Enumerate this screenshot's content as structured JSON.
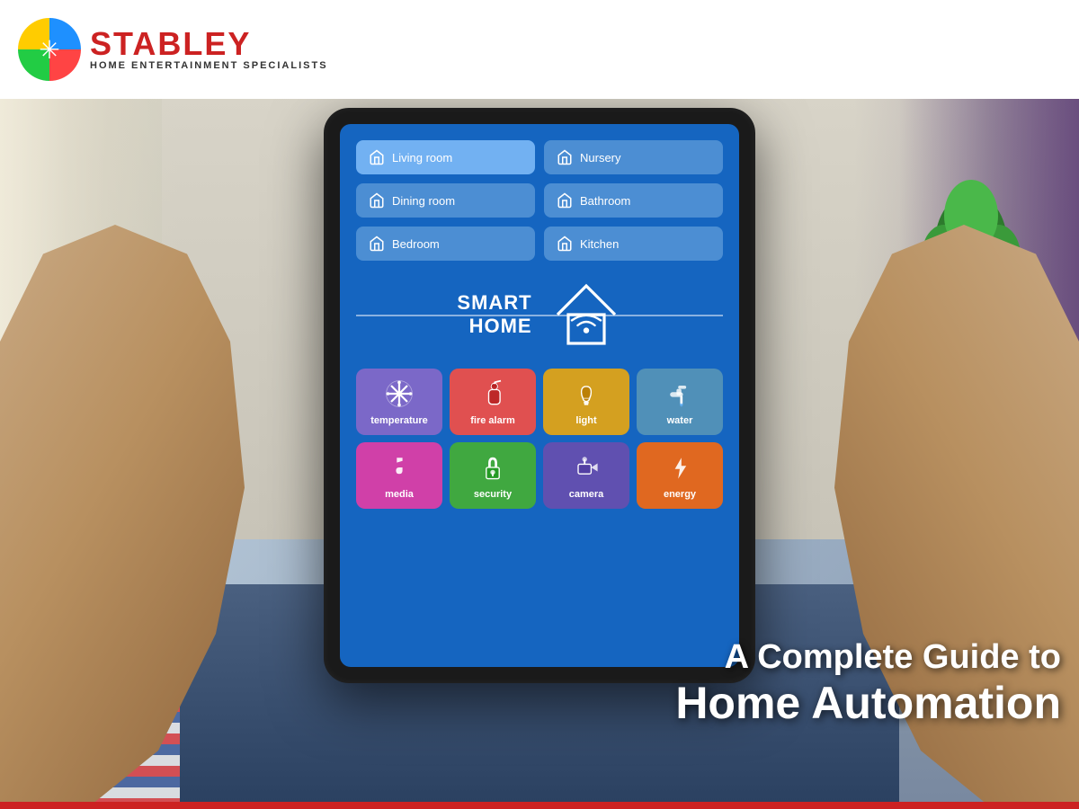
{
  "header": {
    "logo_name": "STABLEY",
    "logo_subtitle": "HOME ENTERTAINMENT SPECIALISTS"
  },
  "tablet": {
    "rooms": [
      {
        "id": "living-room",
        "label": "Living room",
        "active": true
      },
      {
        "id": "nursery",
        "label": "Nursery",
        "active": false
      },
      {
        "id": "dining-room",
        "label": "Dining room",
        "active": false
      },
      {
        "id": "bathroom",
        "label": "Bathroom",
        "active": false
      },
      {
        "id": "bedroom",
        "label": "Bedroom",
        "active": false
      },
      {
        "id": "kitchen",
        "label": "Kitchen",
        "active": false
      }
    ],
    "smart_home_line1": "SMART",
    "smart_home_line2": "HOME",
    "controls": [
      {
        "id": "temperature",
        "label": "temperature",
        "color": "ctrl-temperature"
      },
      {
        "id": "fire-alarm",
        "label": "fire alarm",
        "color": "ctrl-fire"
      },
      {
        "id": "light",
        "label": "light",
        "color": "ctrl-light"
      },
      {
        "id": "water",
        "label": "water",
        "color": "ctrl-water"
      },
      {
        "id": "media",
        "label": "media",
        "color": "ctrl-media"
      },
      {
        "id": "security",
        "label": "security",
        "color": "ctrl-security"
      },
      {
        "id": "camera",
        "label": "camera",
        "color": "ctrl-camera"
      },
      {
        "id": "energy",
        "label": "energy",
        "color": "ctrl-energy"
      }
    ]
  },
  "overlay": {
    "line1": "A Complete Guide to",
    "line2": "Home Automation"
  }
}
